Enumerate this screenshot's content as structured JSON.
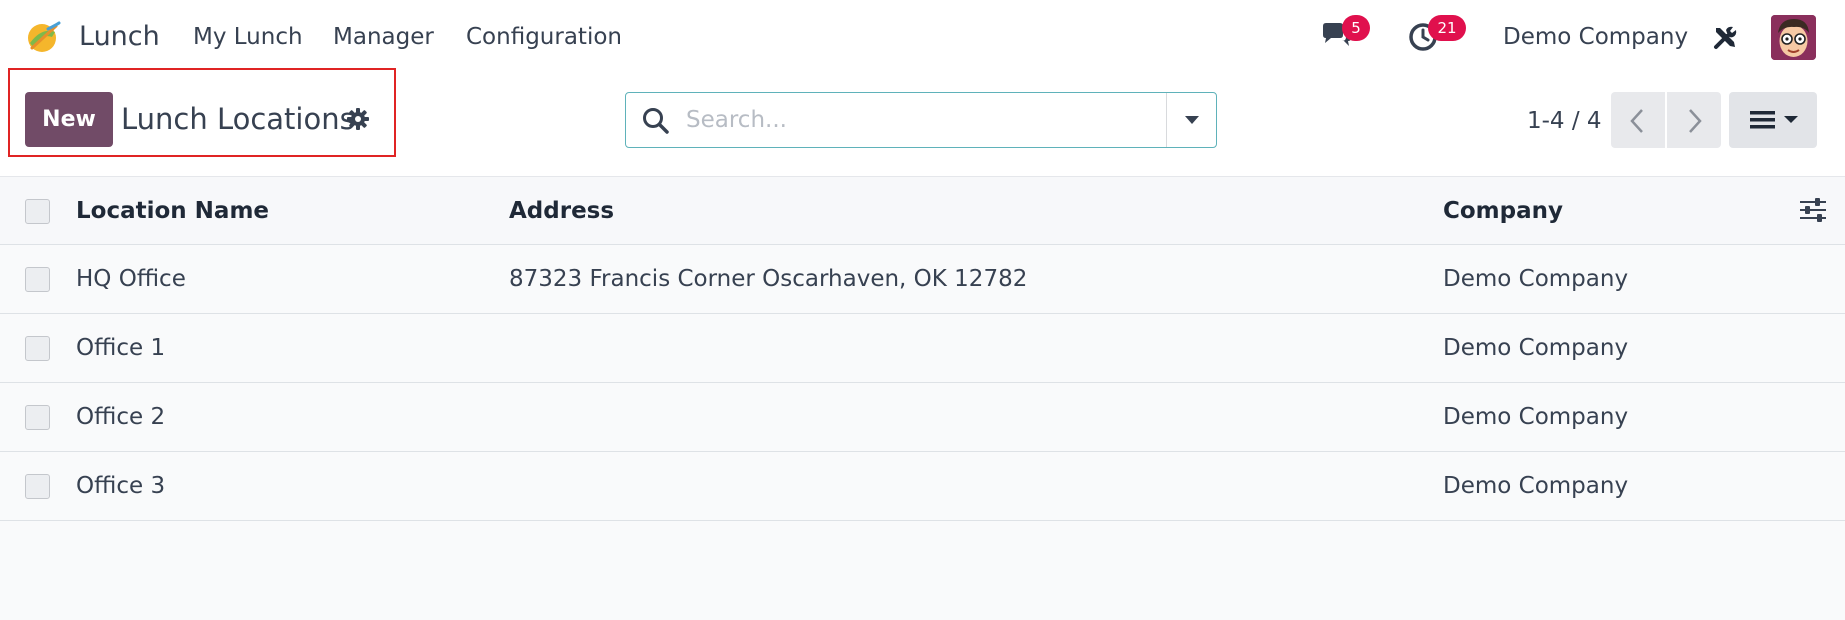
{
  "navbar": {
    "app_name": "Lunch",
    "menu": [
      {
        "label": "My Lunch"
      },
      {
        "label": "Manager"
      },
      {
        "label": "Configuration"
      }
    ],
    "messages_count": "5",
    "activities_count": "21",
    "company": "Demo Company"
  },
  "control_panel": {
    "new_label": "New",
    "title": "Lunch Locations",
    "search_placeholder": "Search...",
    "pager_value": "1-4 / 4"
  },
  "table": {
    "columns": {
      "name": "Location Name",
      "address": "Address",
      "company": "Company"
    },
    "rows": [
      {
        "name": "HQ Office",
        "address": "87323 Francis Corner Oscarhaven, OK 12782",
        "company": "Demo Company"
      },
      {
        "name": "Office 1",
        "address": "",
        "company": "Demo Company"
      },
      {
        "name": "Office 2",
        "address": "",
        "company": "Demo Company"
      },
      {
        "name": "Office 3",
        "address": "",
        "company": "Demo Company"
      }
    ]
  },
  "colors": {
    "primary": "#714b67",
    "badge": "#e0104d",
    "highlight": "#e02424",
    "search_border": "#5fb2ba"
  },
  "icons": [
    "lunch-app-icon",
    "chat-icon",
    "clock-icon",
    "tools-icon",
    "gear-icon",
    "search-icon",
    "chevron-left-icon",
    "chevron-right-icon",
    "list-view-icon",
    "optional-columns-icon"
  ]
}
